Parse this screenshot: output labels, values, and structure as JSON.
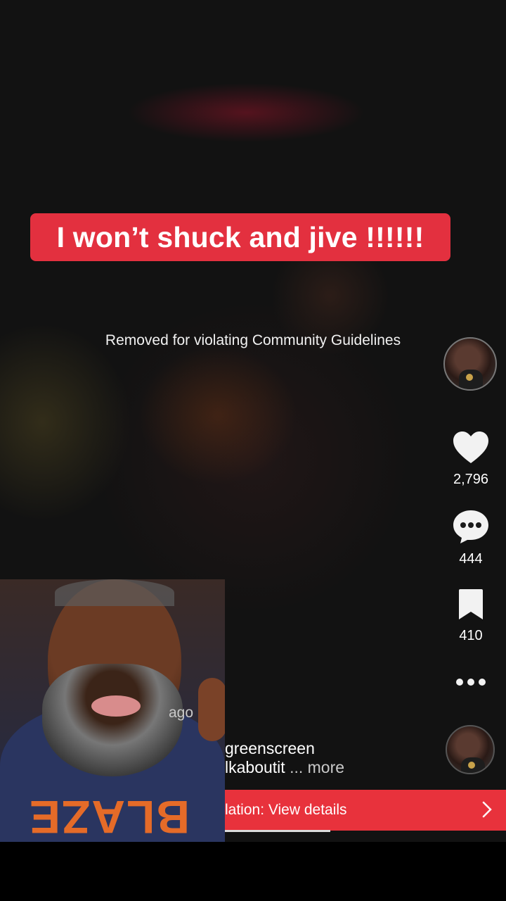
{
  "video": {
    "caption": "I won’t shuck and jive !!!!!!",
    "removed_notice": "Removed for violating Community Guidelines"
  },
  "actions": {
    "likes": "2,796",
    "comments": "444",
    "saves": "410"
  },
  "overlay": {
    "time_ago": "ago",
    "description_line1": "greenscreen",
    "description_line2": "lkaboutit",
    "more_label": "... more"
  },
  "banner": {
    "text": "lation: View details"
  },
  "icons": {
    "like": "heart-icon",
    "comment": "comment-bubble-icon",
    "save": "bookmark-icon",
    "more": "more-dots-icon",
    "chevron": "chevron-right-icon"
  },
  "colors": {
    "caption_bg": "#e3303f",
    "banner_bg": "#e8323c",
    "background": "#121212"
  }
}
